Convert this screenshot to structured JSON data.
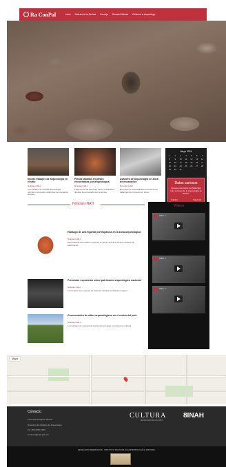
{
  "nav": {
    "logo_text": "Ra ConPal",
    "items": [
      "Inicio",
      "Noticias de la Revista",
      "Consejo",
      "Revista Editorial",
      "Colabora al Arqueólogo"
    ]
  },
  "cards": [
    {
      "title": "Inician trabajos de arqueología en el sitio",
      "date": "Noticias INAH",
      "text": "Los trabajos de rescate arqueológico permiten recuperar evidencias de ocupación antigua."
    },
    {
      "title": "Piezas talladas en piedra encontradas por arqueólogos",
      "date": "Noticias INAH",
      "text": "Fragmentos de escultura fueron localizados durante las excavaciones recientes."
    },
    {
      "title": "Avances de arqueología en zona de excavación",
      "date": "Noticias INAH",
      "text": "El equipo de especialistas documenta los hallazgos del proyecto en curso."
    }
  ],
  "calendar": {
    "month": "Mayo 2024",
    "days": [
      "1",
      "2",
      "3",
      "4",
      "5",
      "6",
      "7",
      "8",
      "9",
      "10",
      "11",
      "12",
      "13",
      "14",
      "15",
      "16",
      "17",
      "18",
      "19",
      "20",
      "21",
      "22",
      "23",
      "24",
      "25",
      "26",
      "27",
      "28",
      "29",
      "30",
      "31"
    ]
  },
  "datos": {
    "title": "Datos curiosos",
    "text": "Conoce más sobre los hallazgos más curiosos de la arqueología de México.",
    "btn_prev": "Anterior",
    "btn_next": "Siguiente"
  },
  "section": {
    "title": "Noticias INAH"
  },
  "news": [
    {
      "title": "Hallazgo de una figurilla prehispánica en la zona arqueológica",
      "date": "Noticias INAH",
      "text": "Especialistas del Instituto registran la pieza cerámica durante trabajos de salvamento."
    },
    {
      "title": "Presentan exposición sobre patrimonio arqueológico nacional",
      "date": "Noticias INAH",
      "text": "La muestra reúne piezas de diversas culturas del México antiguo."
    },
    {
      "title": "Conservación de sitios arqueológicos en el centro del país",
      "date": "Noticias INAH",
      "text": "Los trabajos de mantenimiento buscan proteger el patrimonio cultural."
    }
  ],
  "videos": {
    "title": "Videos",
    "items": [
      "Video 1",
      "Video 2",
      "Video 3"
    ]
  },
  "map": {
    "title": "Mapa"
  },
  "footer": {
    "title": "Contacto",
    "lines": [
      "Zona Arqueológica, México",
      "Dirección del Instituto de Arqueología",
      "Tel. (55) 0000 0000",
      "contacto@inah.gob.mx"
    ],
    "cultura": "CULTURA",
    "cultura_sub": "SECRETARÍA DE CULTURA",
    "inah": "8INAH"
  },
  "bottom": {
    "text": "DERECHOS RESERVADOS · INSTITUTO NACIONAL DE ANTROPOLOGÍA E HISTORIA"
  }
}
